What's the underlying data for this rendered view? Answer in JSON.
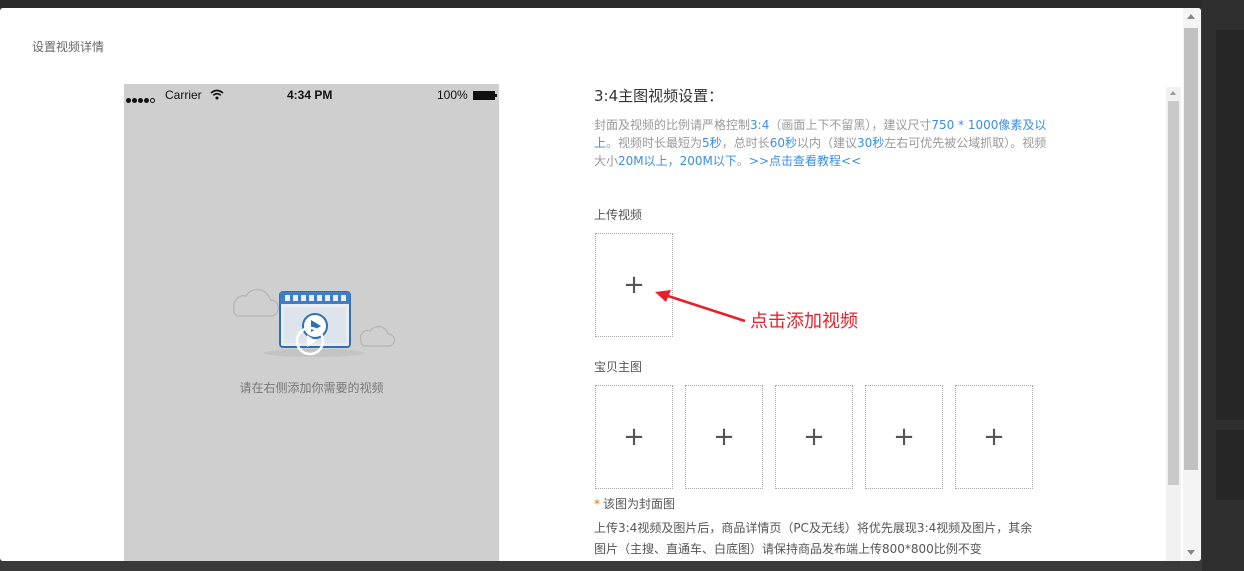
{
  "modal": {
    "title": "设置视频详情"
  },
  "phone_preview": {
    "carrier": "Carrier",
    "time": "4:34 PM",
    "battery": "100%",
    "empty_hint": "请在右侧添加你需要的视频"
  },
  "settings": {
    "section_title": "3:4主图视频设置：",
    "desc_line1_a": "封面及视频的比例请严格控制",
    "desc_line1_b": "3:4",
    "desc_line1_c": "（画面上下不留黑），建议尺寸",
    "desc_line1_d": "750 * 1000像素及以上",
    "desc_line2_a": "。视频时长最短为",
    "desc_line2_b": "5秒",
    "desc_line2_c": "，总时长",
    "desc_line2_d": "60秒",
    "desc_line2_e": "以内（建议",
    "desc_line2_f": "30秒",
    "desc_line2_g": "左右可优先被公域抓取）。视频大小",
    "desc_line2_h": "20M以上，200M以下",
    "desc_line2_i": "。",
    "desc_link": ">>点击查看教程<<",
    "upload_video_label": "上传视频",
    "annotation": "点击添加视频",
    "main_image_label": "宝贝主图",
    "plus_symbol": "+",
    "cover_star": "*",
    "cover_note": "该图为封面图",
    "footnote": "上传3:4视频及图片后，商品详情页（PC及无线）将优先展现3:4视频及图片，其余图片（主搜、直通车、白底图）请保持商品发布端上传800*800比例不变"
  },
  "colors": {
    "accent_blue": "#3a8ee6",
    "annotation_red": "#e8202b",
    "star_orange": "#f56c00"
  }
}
